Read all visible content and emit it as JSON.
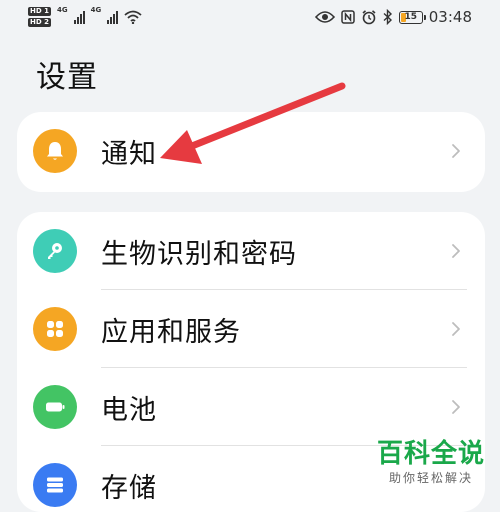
{
  "status_bar": {
    "sim1": "HD 1",
    "sim2": "HD 2",
    "net1": "4G",
    "net2": "4G",
    "battery_level": "15",
    "time": "03:48",
    "icons": [
      "eye-icon",
      "nfc-icon",
      "alarm-icon",
      "bluetooth-icon",
      "battery-icon"
    ]
  },
  "page": {
    "title": "设置"
  },
  "settings": {
    "notifications": {
      "label": "通知",
      "icon": "bell-icon",
      "color": "#f5a623"
    },
    "group": [
      {
        "label": "生物识别和密码",
        "icon": "key-icon",
        "color": "#3fcdb6"
      },
      {
        "label": "应用和服务",
        "icon": "apps-icon",
        "color": "#f5a623"
      },
      {
        "label": "电池",
        "icon": "battery-icon",
        "color": "#43c464"
      },
      {
        "label": "存储",
        "icon": "storage-icon",
        "color": "#3a7bf2"
      }
    ]
  },
  "annotation": {
    "arrow_color": "#e63a40"
  },
  "watermark": {
    "title": "百科全说",
    "subtitle": "助你轻松解决",
    "color": "#1aa84a"
  }
}
